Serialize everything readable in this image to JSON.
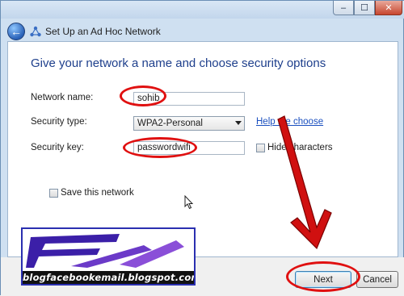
{
  "window": {
    "title": "Set Up an Ad Hoc Network",
    "controls": {
      "minimize": "–",
      "maximize": "☐",
      "close": "✕"
    }
  },
  "page": {
    "heading": "Give your network a name and choose security options",
    "network_name": {
      "label": "Network name:",
      "value": "sohib"
    },
    "security_type": {
      "label": "Security type:",
      "value": "WPA2-Personal",
      "help_link": "Help me choose"
    },
    "security_key": {
      "label": "Security key:",
      "value": "passwordwifi",
      "hide_characters_label": "Hide characters",
      "hide_characters_checked": false
    },
    "save_network": {
      "label": "Save this network",
      "checked": false
    }
  },
  "footer": {
    "next_label": "Next",
    "cancel_label": "Cancel"
  },
  "watermark": {
    "text": "blogfacebookemail.blogspot.com"
  },
  "colors": {
    "annotation_red": "#e01010",
    "heading_blue": "#1e3f8c",
    "link_blue": "#1a4fbf"
  },
  "icons": {
    "back": "back-arrow-icon",
    "network": "network-icon",
    "cursor": "mouse-pointer-icon"
  }
}
